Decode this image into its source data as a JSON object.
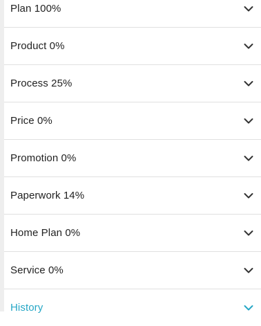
{
  "colors": {
    "text": "#222222",
    "accent": "#26a7c6",
    "divider": "#e0e0e0"
  },
  "sections": [
    {
      "label": "Plan 100%",
      "icon": "chevron-down-icon"
    },
    {
      "label": "Product 0%",
      "icon": "chevron-down-icon"
    },
    {
      "label": "Process 25%",
      "icon": "chevron-down-icon"
    },
    {
      "label": "Price 0%",
      "icon": "chevron-down-icon"
    },
    {
      "label": "Promotion 0%",
      "icon": "chevron-down-icon"
    },
    {
      "label": "Paperwork 14%",
      "icon": "chevron-down-icon"
    },
    {
      "label": "Home Plan 0%",
      "icon": "chevron-down-icon"
    },
    {
      "label": "Service 0%",
      "icon": "chevron-down-icon"
    },
    {
      "label": "History",
      "icon": "chevron-down-icon"
    }
  ]
}
